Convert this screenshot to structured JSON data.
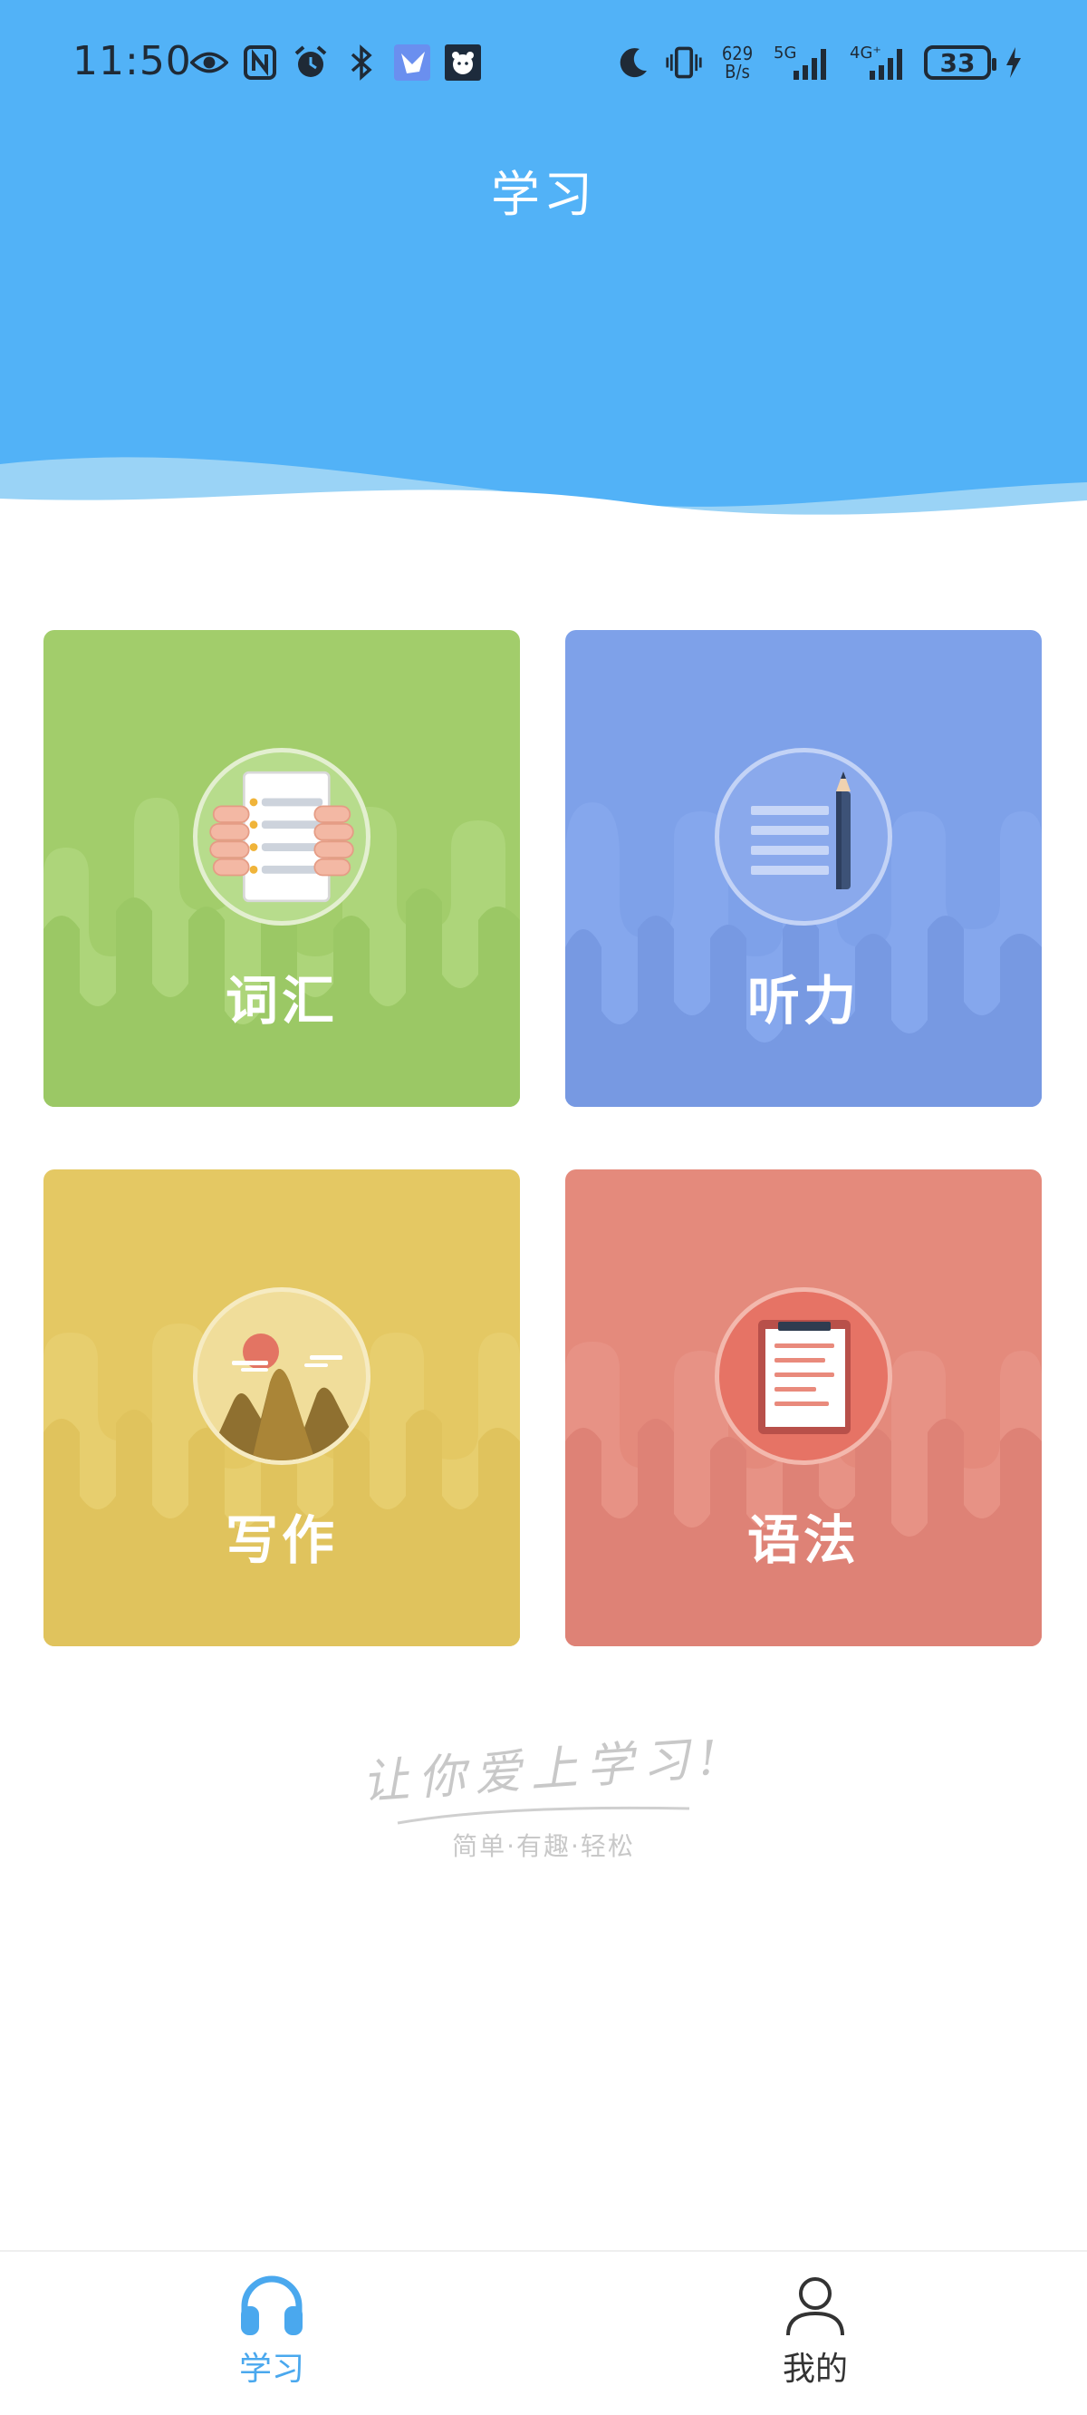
{
  "status_bar": {
    "time": "11:50",
    "net_speed_top": "629",
    "net_speed_bottom": "B/s",
    "network_5g": "5G",
    "network_4g": "4G⁺",
    "battery": "33",
    "left_icons": [
      "eye-icon",
      "nfc-icon",
      "alarm-icon",
      "bluetooth-icon",
      "bird-app-icon",
      "bear-app-icon"
    ],
    "right_icons": [
      "moon-icon",
      "vibrate-icon",
      "signal-icon",
      "signal-icon",
      "charging-icon"
    ]
  },
  "header": {
    "title": "学习",
    "background_color": "#52b2f7"
  },
  "cards": [
    {
      "id": "vocab",
      "label": "词汇",
      "color": "#a2cd6b",
      "icon": "notebook-hands-icon"
    },
    {
      "id": "listen",
      "label": "听力",
      "color": "#7ea1e9",
      "icon": "lines-pencil-icon"
    },
    {
      "id": "write",
      "label": "写作",
      "color": "#e4c863",
      "icon": "mountain-sun-icon"
    },
    {
      "id": "grammar",
      "label": "语法",
      "color": "#e48a7c",
      "icon": "clipboard-icon"
    }
  ],
  "slogan": {
    "main": "让你爱上学习!",
    "sub": "简单·有趣·轻松"
  },
  "bottom_nav": {
    "items": [
      {
        "label": "学习",
        "icon": "headphones-icon",
        "active": true
      },
      {
        "label": "我的",
        "icon": "user-icon",
        "active": false
      }
    ],
    "active_color": "#4aa8ee"
  }
}
